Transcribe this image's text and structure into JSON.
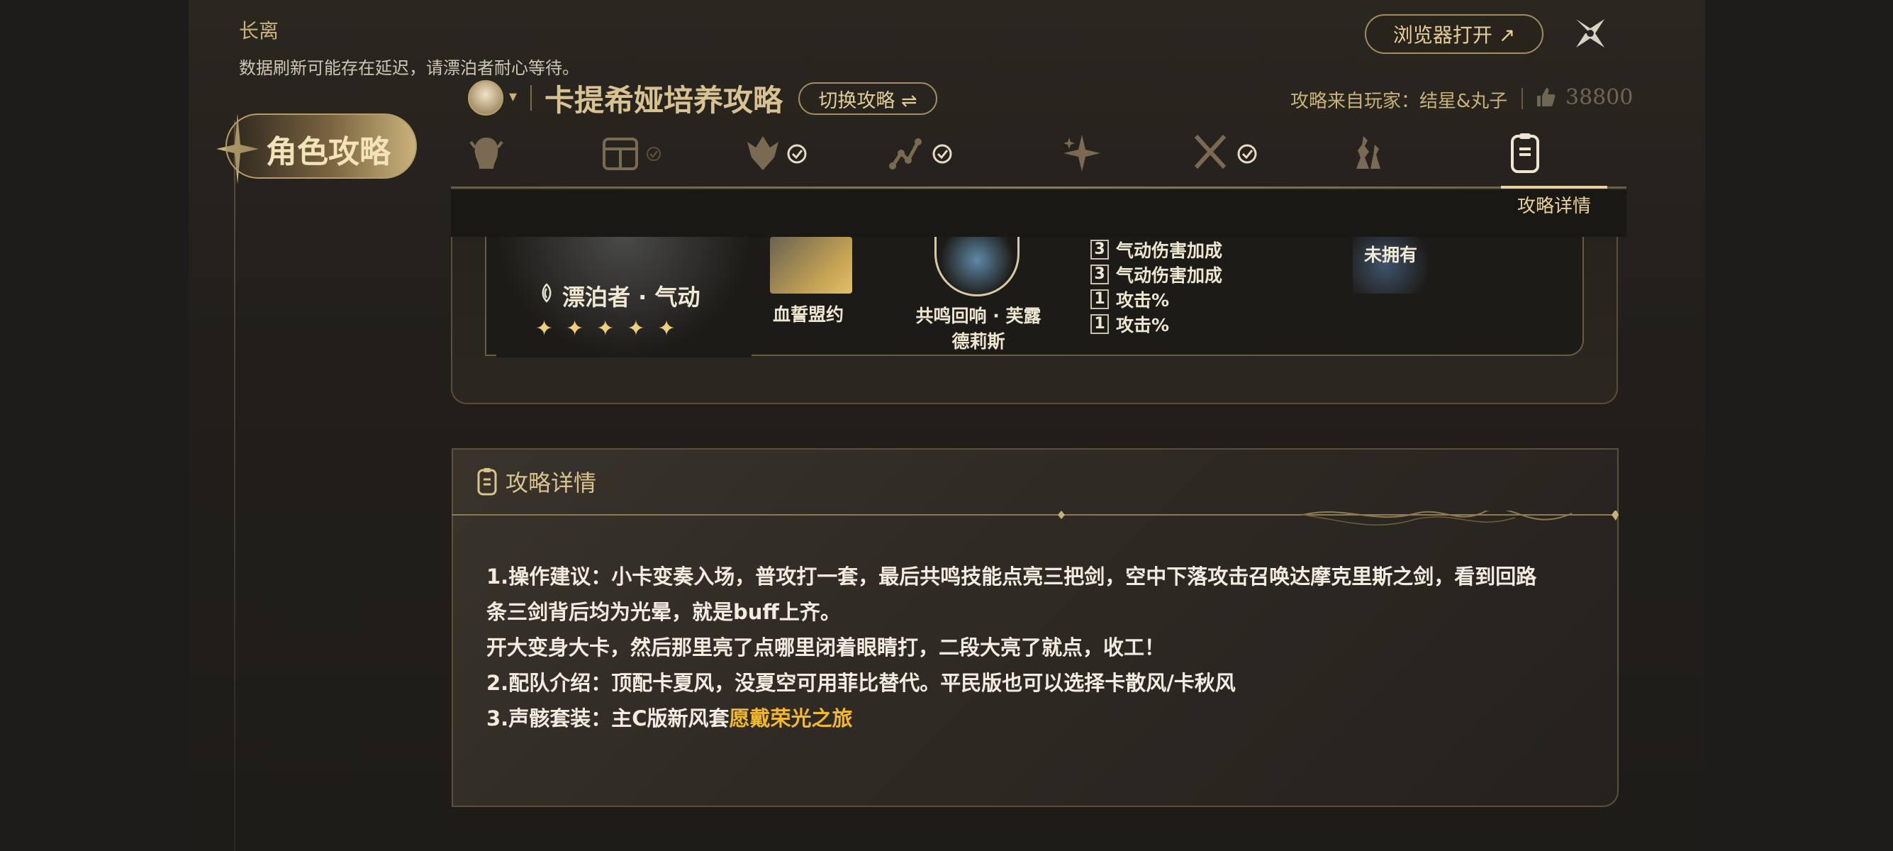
{
  "window": {
    "title": "长离",
    "notice": "数据刷新可能存在延迟，请漂泊者耐心等待。",
    "browser_button": "浏览器打开 ↗"
  },
  "sidebar": {
    "badge_label": "角色攻略"
  },
  "guide": {
    "title": "卡提希娅培养攻略",
    "switch_button": "切换攻略 ⇌",
    "author": "攻略来自玩家：结星&丸子",
    "likes": "38800"
  },
  "tabs": {
    "items": [
      {
        "name": "character",
        "checked": false
      },
      {
        "name": "resonance",
        "checked": true
      },
      {
        "name": "echo",
        "checked": true
      },
      {
        "name": "skill-tree",
        "checked": true
      },
      {
        "name": "forte",
        "checked": false
      },
      {
        "name": "weapon",
        "checked": true
      },
      {
        "name": "team",
        "checked": false
      },
      {
        "name": "guide-detail",
        "checked": false
      }
    ],
    "active_label": "攻略详情"
  },
  "build": {
    "character_name": "漂泊者 · 气动",
    "stars": "✦✦✦✦✦",
    "weapon_name": "血誓盟约",
    "echo_name": "共鸣回响 · 芙露德莉斯",
    "stats": [
      {
        "num": "3",
        "label": "气动伤害加成"
      },
      {
        "num": "3",
        "label": "气动伤害加成"
      },
      {
        "num": "1",
        "label": "攻击%"
      },
      {
        "num": "1",
        "label": "攻击%"
      }
    ],
    "owned_label": "未拥有"
  },
  "detail": {
    "header": "攻略详情",
    "line1": "1.操作建议：小卡变奏入场，普攻打一套，最后共鸣技能点亮三把剑，空中下落攻击召唤达摩克里斯之剑，看到回路",
    "line2": "条三剑背后均为光晕，就是buff上齐。",
    "line3": "开大变身大卡，然后那里亮了点哪里闭着眼睛打，二段大亮了就点，收工！",
    "line4": "2.配队介绍：顶配卡夏风，没夏空可用菲比替代。平民版也可以选择卡散风/卡秋风",
    "line5_prefix": "3.声骸套装：主C版新风套",
    "line5_highlight": "愿戴荣光之旅"
  },
  "colors": {
    "accent_gold": "#d9c48f",
    "highlight": "#f3b82e",
    "background": "#221f1b"
  }
}
